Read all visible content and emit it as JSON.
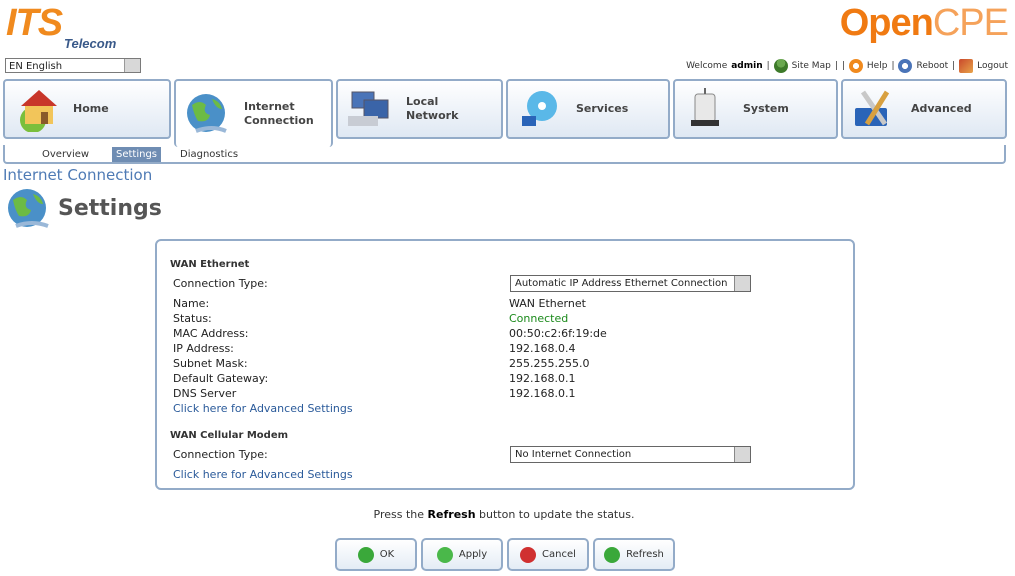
{
  "branding": {
    "left_logo_main": "ITS",
    "left_logo_sub": "Telecom",
    "right_logo_a": "Open",
    "right_logo_b": "CPE"
  },
  "language": {
    "selected": "EN English"
  },
  "toplinks": {
    "welcome": "Welcome",
    "user": "admin",
    "sitemap": "Site Map",
    "help": "Help",
    "reboot": "Reboot",
    "logout": "Logout"
  },
  "tabs": [
    {
      "label": "Home"
    },
    {
      "label": "Internet\nConnection"
    },
    {
      "label": "Local\nNetwork"
    },
    {
      "label": "Services"
    },
    {
      "label": "System"
    },
    {
      "label": "Advanced"
    }
  ],
  "subnav": {
    "overview": "Overview",
    "settings": "Settings",
    "diagnostics": "Diagnostics"
  },
  "section_title": "Internet Connection",
  "page_title": "Settings",
  "wan_ethernet": {
    "heading": "WAN Ethernet",
    "connection_type_label": "Connection Type:",
    "connection_type_value": "Automatic IP Address Ethernet Connection",
    "name_label": "Name:",
    "name": "WAN Ethernet",
    "status_label": "Status:",
    "status": "Connected",
    "mac_label": "MAC Address:",
    "mac": "00:50:c2:6f:19:de",
    "ip_label": "IP Address:",
    "ip": "192.168.0.4",
    "mask_label": "Subnet Mask:",
    "mask": "255.255.255.0",
    "gw_label": "Default Gateway:",
    "gw": "192.168.0.1",
    "dns_label": "DNS Server",
    "dns": "192.168.0.1",
    "advanced_link": "Click here for Advanced Settings"
  },
  "wan_cellular": {
    "heading": "WAN Cellular Modem",
    "connection_type_label": "Connection Type:",
    "connection_type_value": "No Internet Connection",
    "advanced_link": "Click here for Advanced Settings"
  },
  "hint": {
    "pre": "Press the",
    "bold": "Refresh",
    "post": "button to update the status."
  },
  "buttons": {
    "ok": "OK",
    "apply": "Apply",
    "cancel": "Cancel",
    "refresh": "Refresh"
  },
  "colors": {
    "accent": "#93abc8",
    "status_ok": "#1b8a1b",
    "title": "#4f7bb5",
    "brand": "#f07a12"
  }
}
